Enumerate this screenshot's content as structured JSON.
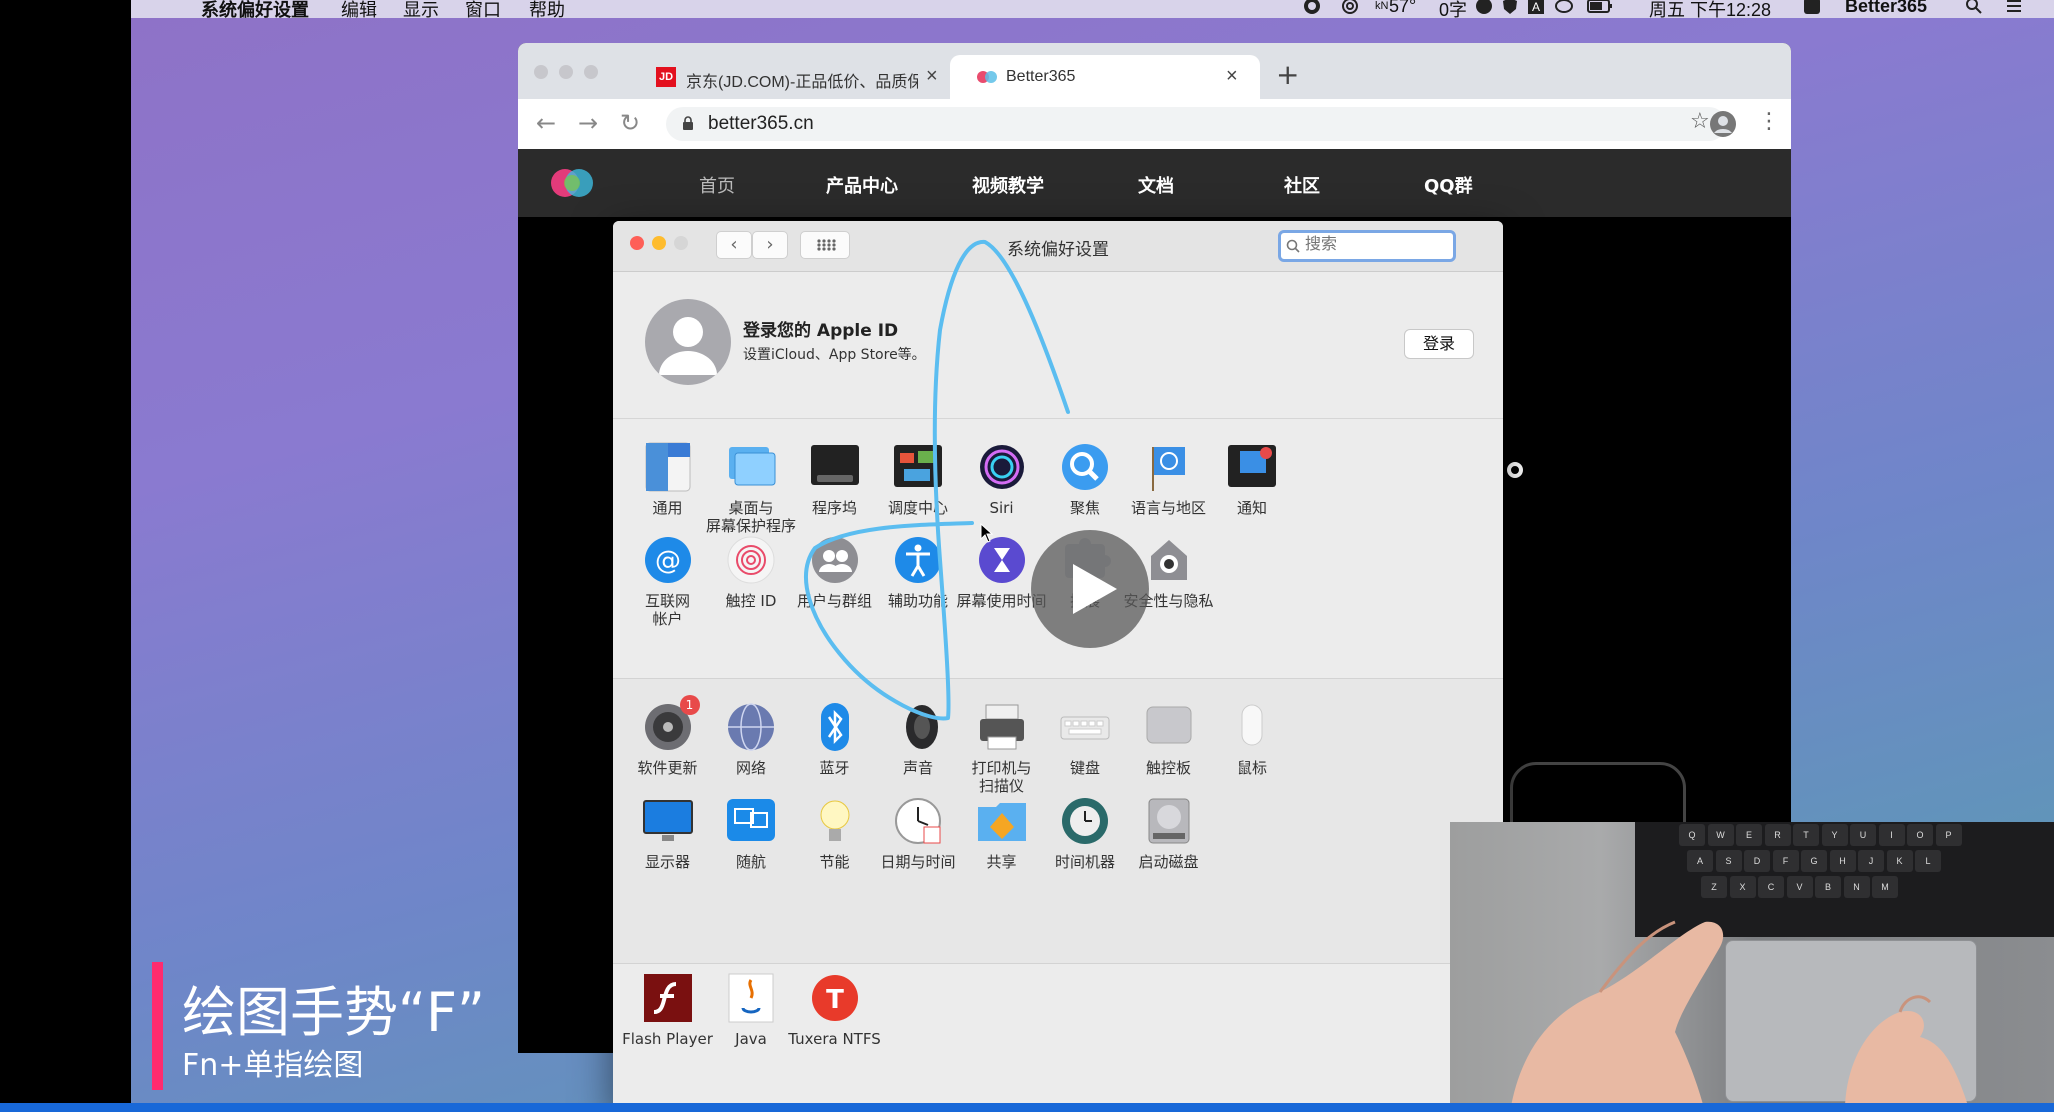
{
  "menubar": {
    "app": "系统偏好设置",
    "items": [
      "编辑",
      "显示",
      "窗口",
      "帮助"
    ],
    "weather": "57°",
    "clock": "周五 下午12:28",
    "user": "Better365"
  },
  "browser": {
    "tabs": [
      {
        "label": "京东(JD.COM)-正品低价、品质保",
        "active": false
      },
      {
        "label": "Better365",
        "active": true
      }
    ],
    "url": "better365.cn",
    "site_nav": [
      "首页",
      "产品中心",
      "视频教学",
      "文档",
      "社区",
      "QQ群"
    ]
  },
  "prefs": {
    "title": "系统偏好设置",
    "search_placeholder": "搜索",
    "apple_id_title": "登录您的 Apple ID",
    "apple_id_sub": "设置iCloud、App Store等。",
    "login_label": "登录",
    "row1": [
      {
        "label": "通用",
        "icon": "general-icon"
      },
      {
        "label": "桌面与\n屏幕保护程序",
        "icon": "desktop-screensaver-icon"
      },
      {
        "label": "程序坞",
        "icon": "dock-icon"
      },
      {
        "label": "调度中心",
        "icon": "mission-control-icon"
      },
      {
        "label": "Siri",
        "icon": "siri-icon"
      },
      {
        "label": "聚焦",
        "icon": "spotlight-icon"
      },
      {
        "label": "语言与地区",
        "icon": "language-region-icon"
      },
      {
        "label": "通知",
        "icon": "notifications-icon"
      }
    ],
    "row2": [
      {
        "label": "互联网\n帐户",
        "icon": "internet-accounts-icon"
      },
      {
        "label": "触控 ID",
        "icon": "touch-id-icon"
      },
      {
        "label": "用户与群组",
        "icon": "users-groups-icon"
      },
      {
        "label": "辅助功能",
        "icon": "accessibility-icon"
      },
      {
        "label": "屏幕使用时间",
        "icon": "screen-time-icon"
      },
      {
        "label": "扩展",
        "icon": "extensions-icon"
      },
      {
        "label": "安全性与隐私",
        "icon": "security-privacy-icon"
      }
    ],
    "row3": [
      {
        "label": "软件更新",
        "icon": "software-update-icon",
        "badge": "1"
      },
      {
        "label": "网络",
        "icon": "network-icon"
      },
      {
        "label": "蓝牙",
        "icon": "bluetooth-icon"
      },
      {
        "label": "声音",
        "icon": "sound-icon"
      },
      {
        "label": "打印机与\n扫描仪",
        "icon": "printers-scanners-icon"
      },
      {
        "label": "键盘",
        "icon": "keyboard-icon"
      },
      {
        "label": "触控板",
        "icon": "trackpad-icon"
      },
      {
        "label": "鼠标",
        "icon": "mouse-icon"
      }
    ],
    "row4": [
      {
        "label": "显示器",
        "icon": "displays-icon"
      },
      {
        "label": "随航",
        "icon": "sidecar-icon"
      },
      {
        "label": "节能",
        "icon": "energy-saver-icon"
      },
      {
        "label": "日期与时间",
        "icon": "date-time-icon"
      },
      {
        "label": "共享",
        "icon": "sharing-icon"
      },
      {
        "label": "时间机器",
        "icon": "time-machine-icon"
      },
      {
        "label": "启动磁盘",
        "icon": "startup-disk-icon"
      }
    ],
    "row5": [
      {
        "label": "Flash Player",
        "icon": "flash-player-icon"
      },
      {
        "label": "Java",
        "icon": "java-icon"
      },
      {
        "label": "Tuxera NTFS",
        "icon": "tuxera-ntfs-icon"
      }
    ]
  },
  "caption": {
    "title": "绘图手势“F”",
    "subtitle": "Fn+单指绘图"
  },
  "keyboard_keys": [
    "Q",
    "W",
    "E",
    "R",
    "T",
    "Y",
    "U",
    "I",
    "O",
    "P",
    "A",
    "S",
    "D",
    "F",
    "G",
    "H",
    "J",
    "K",
    "L",
    "Z",
    "X",
    "C",
    "V",
    "B",
    "N",
    "M"
  ],
  "colors": {
    "accent": "#ff2b6e",
    "gesture": "#5bbdf0",
    "site_header": "#2b2b2b"
  }
}
